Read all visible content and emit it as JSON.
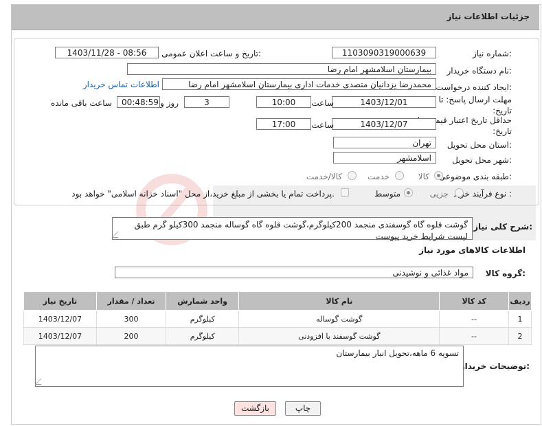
{
  "page_title": "جزئیات اطلاعات نیاز",
  "fields": {
    "need_number_label": "شماره نیاز:",
    "need_number": "1103090319000639",
    "announce_label": "تاریخ و ساعت اعلان عمومی:",
    "announce_value": "1403/11/28 - 08:56",
    "buyer_label": "نام دستگاه خریدار:",
    "buyer_value": "بیمارستان اسلامشهر   امام رضا",
    "creator_label": "ایجاد کننده درخواست:",
    "creator_value": "محمدرضا یزدانیان متصدی خدمات اداری بیمارستان اسلامشهر   امام رضا",
    "contact_link": "اطلاعات تماس خریدار",
    "deadline_label": "مهلت ارسال پاسخ: تا تاریخ:",
    "deadline_date": "1403/12/01",
    "time_label": "ساعت",
    "deadline_time": "10:00",
    "days_value": "3",
    "days_label": "روز و",
    "remaining_time": "00:48:59",
    "remaining_label": "ساعت باقی مانده",
    "validity_label": "حداقل تاریخ اعتبار قیمت: تا تاریخ:",
    "validity_date": "1403/12/07",
    "validity_time": "17:00",
    "province_label": "استان محل تحویل:",
    "province_value": "تهران",
    "city_label": "شهر محل تحویل:",
    "city_value": "اسلامشهر",
    "category_label": "طبقه بندی موضوعی:",
    "category_options": [
      "کالا",
      "خدمت",
      "کالا/خدمت"
    ],
    "process_label": "نوع فرآیند خرید :",
    "process_options": [
      "جزیی",
      "متوسط"
    ],
    "payment_note": "پرداخت تمام یا بخشی از مبلغ خرید،از محل \"اسناد خزانه اسلامی\" خواهد بود."
  },
  "description": {
    "label": "شرح کلی نیاز:",
    "text": "گوشت قلوه گاه گوسفندی منجمد 200کیلوگرم،گوشت قلوه گاه گوساله منجمد 300کیلو گرم طبق لیست شرایط خرید پیوست"
  },
  "goods_section_title": "اطلاعات کالاهای مورد نیاز",
  "goods_group_label": "گروه کالا:",
  "goods_group_value": "مواد غذائی و نوشیدنی",
  "table": {
    "headers": [
      "ردیف",
      "کد کالا",
      "نام کالا",
      "واحد شمارش",
      "تعداد / مقدار",
      "تاریخ نیاز"
    ],
    "rows": [
      [
        "1",
        "--",
        "گوشت گوساله",
        "کیلوگرم",
        "300",
        "1403/12/07"
      ],
      [
        "2",
        "--",
        "گوشت گوسفند با افزودنی",
        "کیلوگرم",
        "200",
        "1403/12/07"
      ]
    ]
  },
  "buyer_notes_label": "توضیحات خریدار:",
  "buyer_notes": "تسویه 6 ماهه،تحویل انبار بیمارستان",
  "buttons": {
    "print": "چاپ",
    "back": "بازگشت"
  }
}
